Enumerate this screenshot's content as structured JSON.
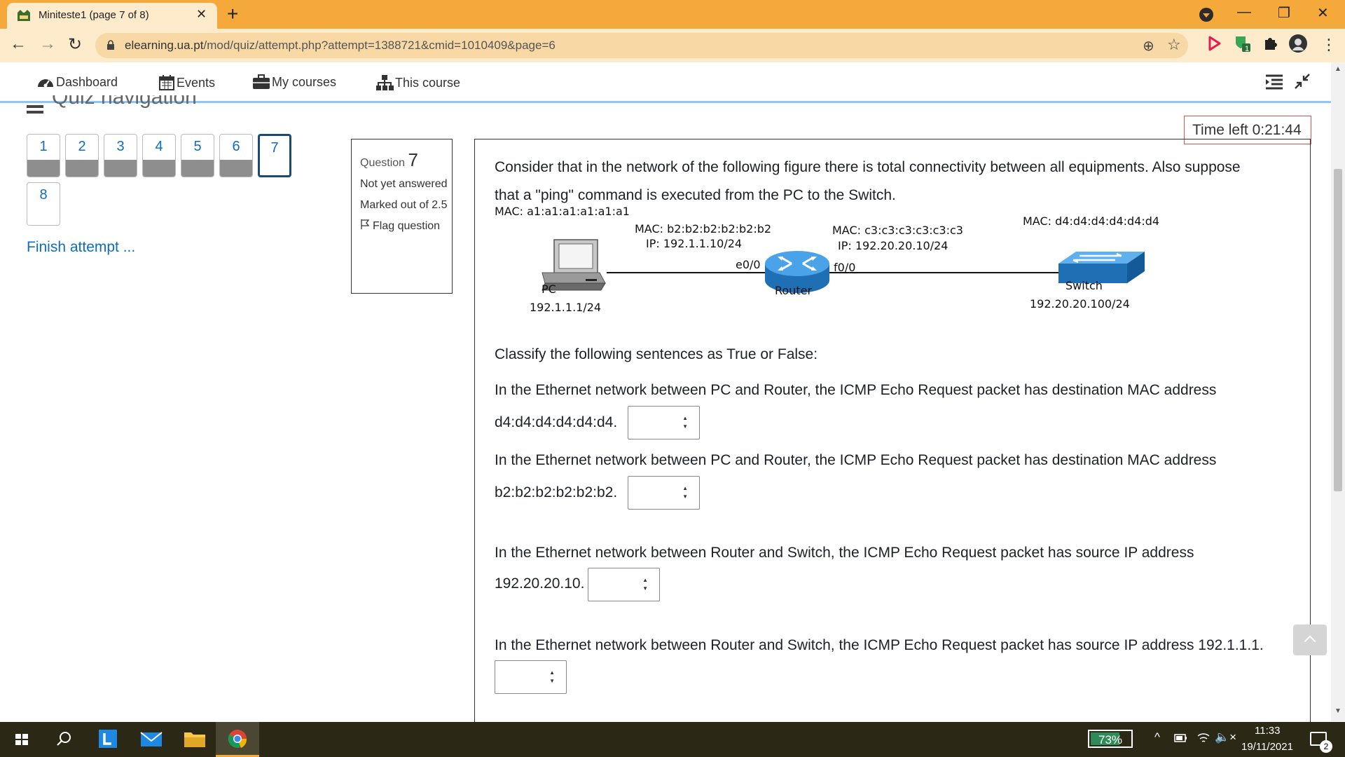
{
  "browser": {
    "tab_title": "Miniteste1 (page 7 of 8)",
    "tab_close": "✕",
    "new_tab": "+",
    "window_controls": {
      "minimize": "—",
      "maximize": "❐",
      "close": "✕"
    },
    "nav": {
      "back": "←",
      "forward": "→",
      "reload": "↻"
    },
    "url_host": "elearning.ua.pt",
    "url_path": "/mod/quiz/attempt.php?attempt=1388721&cmid=1010409&page=6",
    "zoom_icon": "⊕",
    "star_icon": "☆",
    "extension_badge": "1",
    "extension_colors": {
      "play": "#e8194b",
      "shield": "#3aa757",
      "avatar": "#333333"
    },
    "more_menu": "⋮"
  },
  "navbar": {
    "items": [
      {
        "label": "Dashboard",
        "icon": "dashboard-icon"
      },
      {
        "label": "Events",
        "icon": "calendar-icon"
      },
      {
        "label": "My courses",
        "icon": "briefcase-icon"
      },
      {
        "label": "This course",
        "icon": "sitemap-icon"
      }
    ]
  },
  "quiz_nav": {
    "heading": "Quiz navigation",
    "buttons": [
      {
        "label": "1",
        "state": "answered"
      },
      {
        "label": "2",
        "state": "answered"
      },
      {
        "label": "3",
        "state": "answered"
      },
      {
        "label": "4",
        "state": "answered"
      },
      {
        "label": "5",
        "state": "answered"
      },
      {
        "label": "6",
        "state": "answered"
      },
      {
        "label": "7",
        "state": "current"
      },
      {
        "label": "8",
        "state": "notyet"
      }
    ],
    "finish": "Finish attempt ..."
  },
  "timer": "Time left 0:21:44",
  "question_info": {
    "prefix": "Question",
    "number": "7",
    "status": "Not yet answered",
    "marked": "Marked out of 2.5",
    "flag": "Flag question"
  },
  "question": {
    "intro_line1": "Consider that in the network of the following figure there is total connectivity between all equipments. Also suppose",
    "intro_line2": "that a \"ping\" command is executed from the PC to the Switch.",
    "classify": "Classify the following sentences as True or False:",
    "sentences": [
      {
        "line1": "In the Ethernet network between PC and Router, the ICMP Echo Request packet has destination MAC address",
        "line2": "d4:d4:d4:d4:d4:d4."
      },
      {
        "line1": "In the Ethernet network between PC and Router, the ICMP Echo Request packet has destination MAC address",
        "line2": "b2:b2:b2:b2:b2:b2."
      },
      {
        "line1": "In the Ethernet network between Router and Switch, the ICMP Echo Request packet has source IP address",
        "line2": "192.20.20.10."
      },
      {
        "line1": "In the Ethernet network between Router and Switch, the ICMP Echo Request packet has source IP address 192.1.1.1.",
        "line2": ""
      }
    ]
  },
  "diagram": {
    "pc_mac": "MAC: a1:a1:a1:a1:a1:a1",
    "pc_label": "PC",
    "pc_ip": "192.1.1.1/24",
    "router_e0_mac": "MAC: b2:b2:b2:b2:b2:b2",
    "router_e0_ip": "IP: 192.1.1.10/24",
    "router_e0": "e0/0",
    "router_label": "Router",
    "router_f0_mac": "MAC: c3:c3:c3:c3:c3:c3",
    "router_f0_ip": "IP: 192.20.20.10/24",
    "router_f0": "f0/0",
    "switch_mac": "MAC: d4:d4:d4:d4:d4:d4",
    "switch_label": "Switch",
    "switch_ip": "192.20.20.100/24"
  },
  "taskbar": {
    "battery": "73%",
    "battery_level": 0.73,
    "tray_chevron": "^",
    "tray_volume": "🔈×",
    "time": "11:33",
    "date": "19/11/2021",
    "notifications": "2",
    "colors": {
      "accent": "#f6a93b",
      "taskbar": "#2b2815"
    }
  }
}
